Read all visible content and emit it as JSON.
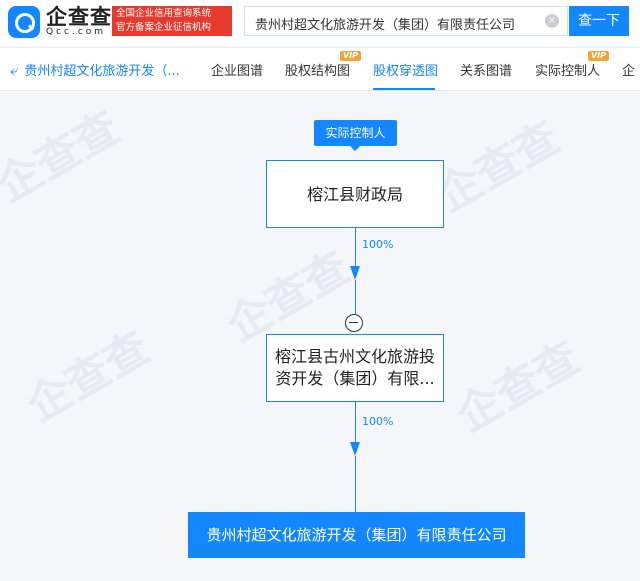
{
  "brand": {
    "name": "企查查",
    "domain": "Qcc.com",
    "tagline_line1": "全国企业信用查询系统",
    "tagline_line2": "官方备案企业征信机构"
  },
  "search": {
    "value": "贵州村超文化旅游开发（集团）有限责任公司",
    "clear_icon": "×",
    "button_label": "查一下"
  },
  "nav": {
    "back_label": "贵州村超文化旅游开发（...",
    "tabs": [
      {
        "label": "企业图谱",
        "vip": false
      },
      {
        "label": "股权结构图",
        "vip": true
      },
      {
        "label": "股权穿透图",
        "vip": false,
        "active": true
      },
      {
        "label": "关系图谱",
        "vip": false
      },
      {
        "label": "实际控制人",
        "vip": true
      },
      {
        "label": "企",
        "vip": false
      }
    ],
    "vip_label": "VIP"
  },
  "graph": {
    "controller_tag": "实际控制人",
    "top_node": "榕江县财政局",
    "edge1_pct": "100%",
    "middle_node_line1": "榕江县古州文化旅游投",
    "middle_node_line2": "资开发（集团）有限...",
    "edge2_pct": "100%",
    "bottom_node": "贵州村超文化旅游开发（集团）有限责任公司"
  },
  "colors": {
    "primary": "#1287ff",
    "tag_red": "#e63a2e",
    "vip_orange": "#f2a33a"
  }
}
